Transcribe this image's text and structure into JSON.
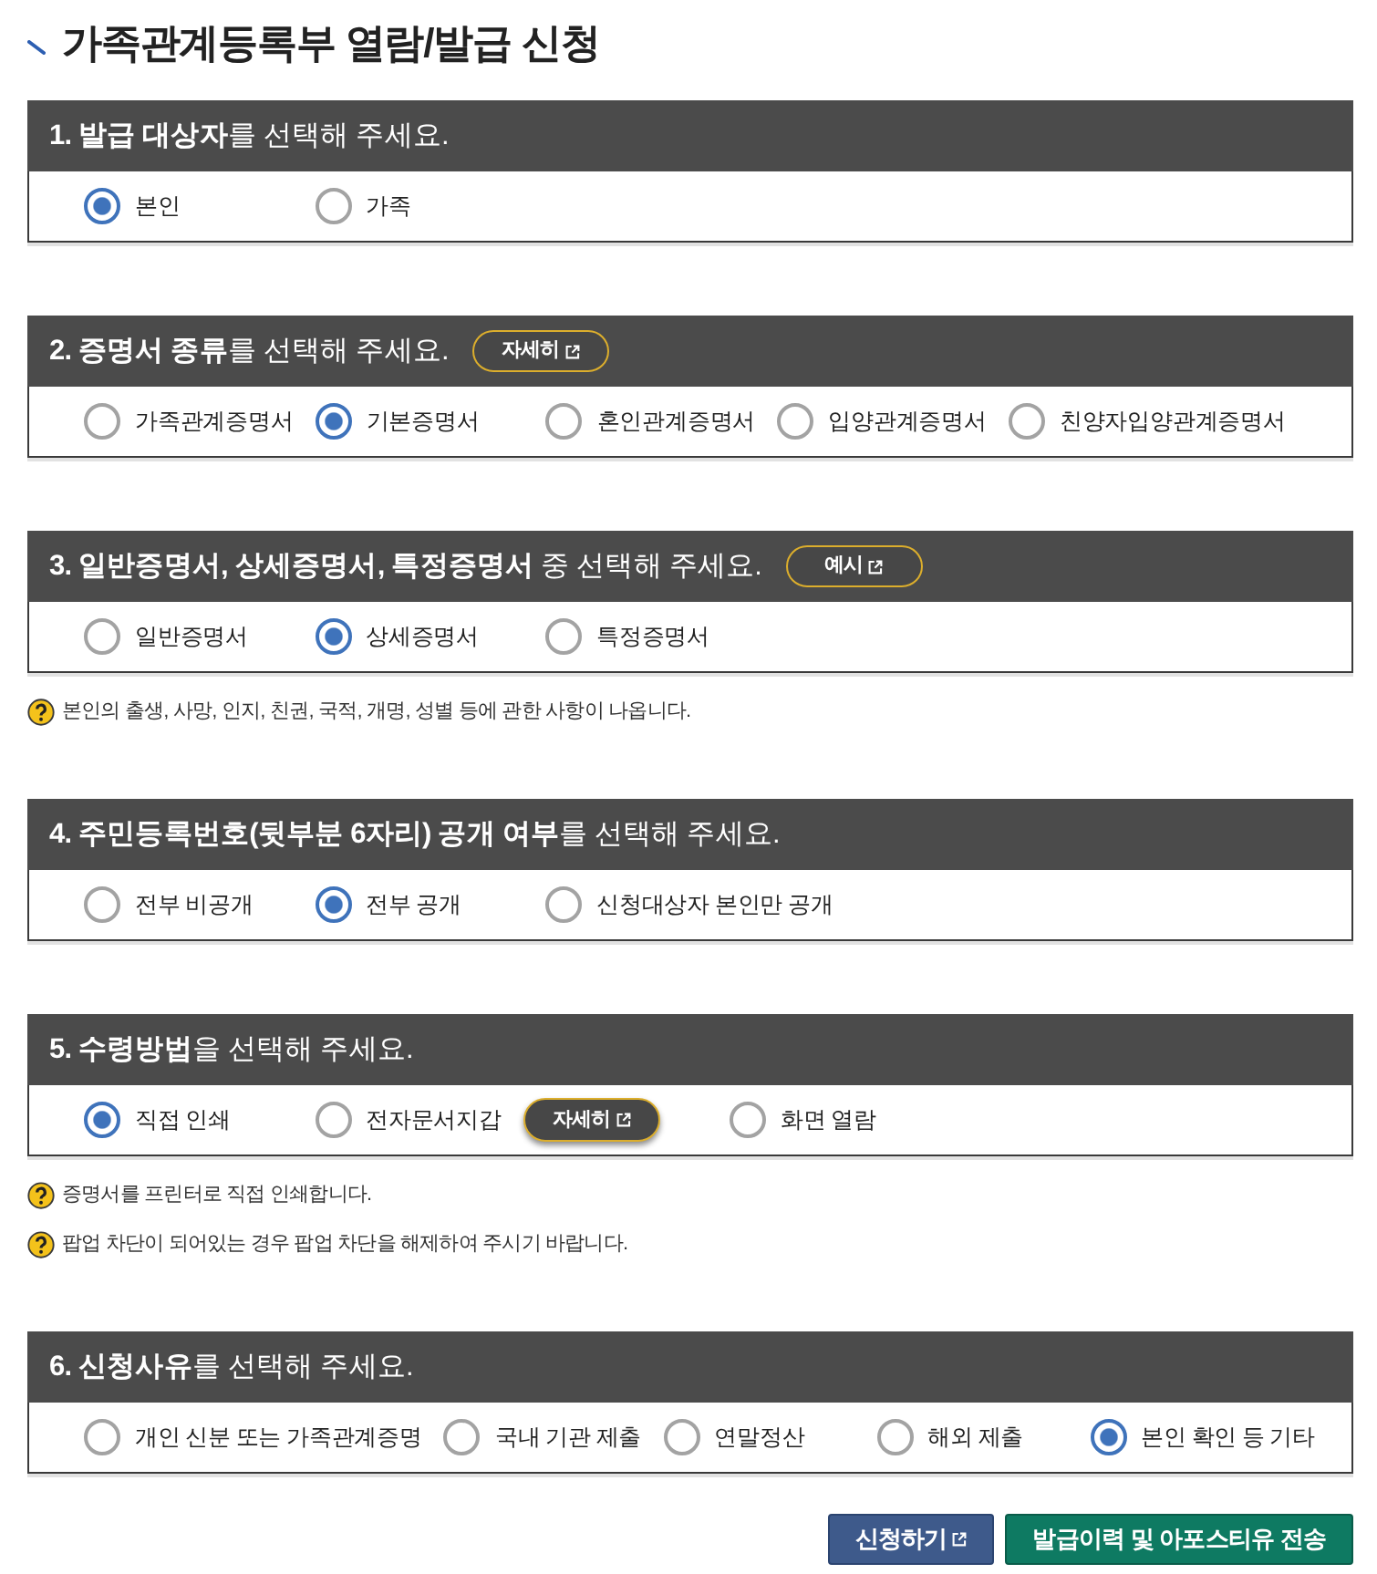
{
  "title": "가족관계등록부 열람/발급 신청",
  "sections": [
    {
      "heading": "**1. 발급 대상자**를 선택해 주세요.",
      "options": [
        {
          "label": "본인",
          "selected": true
        },
        {
          "label": "가족",
          "selected": false
        }
      ]
    },
    {
      "heading": "**2. 증명서 종류**를 선택해 주세요.",
      "heading_button": {
        "label": "자세히"
      },
      "options": [
        {
          "label": "가족관계증명서",
          "selected": false
        },
        {
          "label": "기본증명서",
          "selected": true
        },
        {
          "label": "혼인관계증명서",
          "selected": false
        },
        {
          "label": "입양관계증명서",
          "selected": false
        },
        {
          "label": "친양자입양관계증명서",
          "selected": false
        }
      ]
    },
    {
      "heading": "**3. 일반증명서, 상세증명서, 특정증명서** 중 선택해 주세요.",
      "heading_button": {
        "label": "예시"
      },
      "options": [
        {
          "label": "일반증명서",
          "selected": false
        },
        {
          "label": "상세증명서",
          "selected": true
        },
        {
          "label": "특정증명서",
          "selected": false
        }
      ],
      "notes": [
        "본인의 출생, 사망, 인지, 친권, 국적, 개명, 성별 등에 관한 사항이 나옵니다."
      ]
    },
    {
      "heading": "**4. 주민등록번호(뒷부분 6자리) 공개 여부**를 선택해 주세요.",
      "options": [
        {
          "label": "전부 비공개",
          "selected": false
        },
        {
          "label": "전부 공개",
          "selected": true
        },
        {
          "label": "신청대상자 본인만 공개",
          "selected": false
        }
      ]
    },
    {
      "heading": "**5. 수령방법**을 선택해 주세요.",
      "options": [
        {
          "label": "직접 인쇄",
          "selected": true
        },
        {
          "label": "전자문서지갑",
          "selected": false,
          "button": {
            "label": "자세히"
          }
        },
        {
          "label": "화면 열람",
          "selected": false
        }
      ],
      "notes": [
        "증명서를 프린터로 직접 인쇄합니다.",
        "팝업 차단이 되어있는 경우 팝업 차단을 해제하여 주시기 바랍니다."
      ]
    },
    {
      "heading": "**6. 신청사유**를 선택해 주세요.",
      "options": [
        {
          "label": "개인 신분 또는 가족관계증명",
          "selected": false
        },
        {
          "label": "국내 기관 제출",
          "selected": false
        },
        {
          "label": "연말정산",
          "selected": false
        },
        {
          "label": "해외 제출",
          "selected": false
        },
        {
          "label": "본인 확인 등 기타",
          "selected": true
        }
      ]
    }
  ],
  "buttons": [
    {
      "label": "신청하기",
      "kind": "link"
    },
    {
      "label": "발급이력 및 아포스티유 전송",
      "kind": "action"
    }
  ]
}
